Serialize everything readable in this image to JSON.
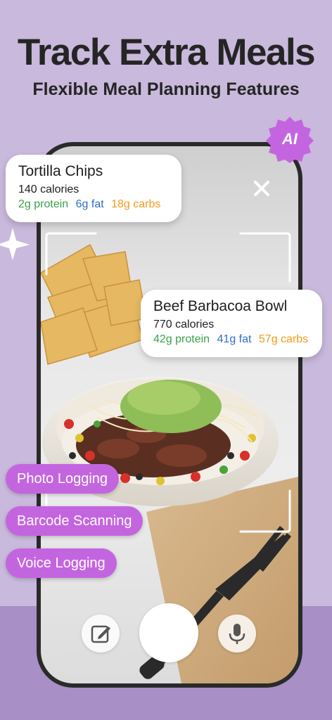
{
  "header": {
    "title": "Track Extra Meals",
    "subtitle": "Flexible Meal Planning Features"
  },
  "badge": {
    "label": "AI",
    "color": "#c465e0"
  },
  "cards": [
    {
      "title": "Tortilla Chips",
      "calories": "140 calories",
      "protein": "2g protein",
      "fat": "6g fat",
      "carbs": "18g carbs"
    },
    {
      "title": "Beef Barbacoa Bowl",
      "calories": "770 calories",
      "protein": "42g protein",
      "fat": "41g fat",
      "carbs": "57g carbs"
    }
  ],
  "features": [
    {
      "label": "Photo Logging"
    },
    {
      "label": "Barcode Scanning"
    },
    {
      "label": "Voice Logging"
    }
  ],
  "controls": {
    "edit_icon": "pencil-square-icon",
    "shutter": "shutter-button",
    "mic_icon": "microphone-icon",
    "close_icon": "close-icon"
  },
  "colors": {
    "background": "#c9b9dc",
    "band": "#a88fc6",
    "protein": "#3aa048",
    "fat": "#2f6fc1",
    "carbs": "#f09a1a",
    "pill": "#c465e0"
  }
}
